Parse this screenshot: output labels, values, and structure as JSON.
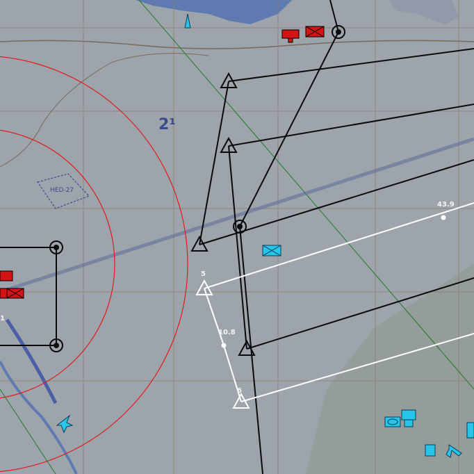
{
  "map": {
    "grid_label": "2¹",
    "area_label": "HED-27",
    "colors": {
      "terrain": "#9ea4ab",
      "water": "#5f7ab0",
      "route_black": "#0a0a0a",
      "route_white": "#ffffff",
      "range_ring": "#e01a1a",
      "grid_line": "#8a7a6a",
      "enemy_unit": "#d41414",
      "friendly_unit": "#27c5e8"
    },
    "waypoint_labels": {
      "wp5": "5",
      "wp10_8": "10.8",
      "wp6": "6",
      "wp43_9": "43.9",
      "left_edge": "1"
    },
    "icons": [
      "enemy-radar-icon",
      "enemy-armor-icon",
      "friendly-infantry-icon",
      "friendly-aircraft-icon",
      "friendly-sam-icon",
      "friendly-recon-icon",
      "airfield-tower-icon"
    ]
  }
}
